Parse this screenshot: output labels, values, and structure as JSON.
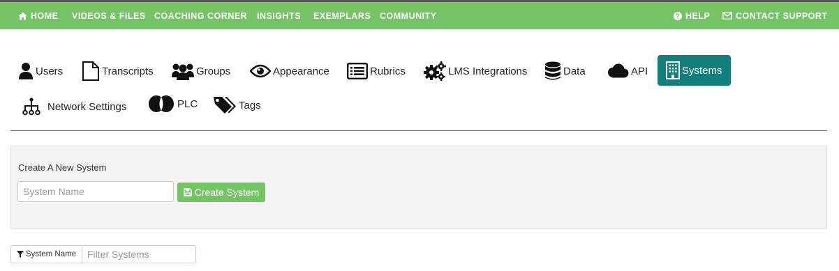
{
  "topnav": {
    "left": [
      {
        "label": "HOME",
        "icon": "home-icon"
      },
      {
        "label": "VIDEOS & FILES"
      },
      {
        "label": "COACHING CORNER"
      },
      {
        "label": "INSIGHTS"
      },
      {
        "label": "EXEMPLARS"
      },
      {
        "label": "COMMUNITY"
      }
    ],
    "right": [
      {
        "label": "HELP",
        "icon": "question-circle-icon"
      },
      {
        "label": "CONTACT SUPPORT",
        "icon": "envelope-icon"
      }
    ],
    "color": "#74c465"
  },
  "tabs": [
    {
      "label": "Users",
      "icon": "user-icon"
    },
    {
      "label": "Transcripts",
      "icon": "file-icon"
    },
    {
      "label": "Groups",
      "icon": "users-icon"
    },
    {
      "label": "Appearance",
      "icon": "eye-icon"
    },
    {
      "label": "Rubrics",
      "icon": "list-alt-icon"
    },
    {
      "label": "LMS Integrations",
      "icon": "cogs-icon"
    },
    {
      "label": "Data",
      "icon": "database-icon"
    },
    {
      "label": "API",
      "icon": "cloud-icon"
    },
    {
      "label": "Systems",
      "icon": "building-icon",
      "active": true
    },
    {
      "label": "Network Settings",
      "icon": "sitemap-icon"
    },
    {
      "label": "PLC",
      "icon": "plc-icon"
    },
    {
      "label": "Tags",
      "icon": "tags-icon"
    }
  ],
  "active_tab_color": "#137f7c",
  "create_panel": {
    "title": "Create A New System",
    "name_placeholder": "System Name",
    "create_label": "Create System",
    "create_icon": "save-icon"
  },
  "filter": {
    "addon_label": "System Name",
    "addon_icon": "filter-icon",
    "placeholder": "Filter Systems"
  }
}
